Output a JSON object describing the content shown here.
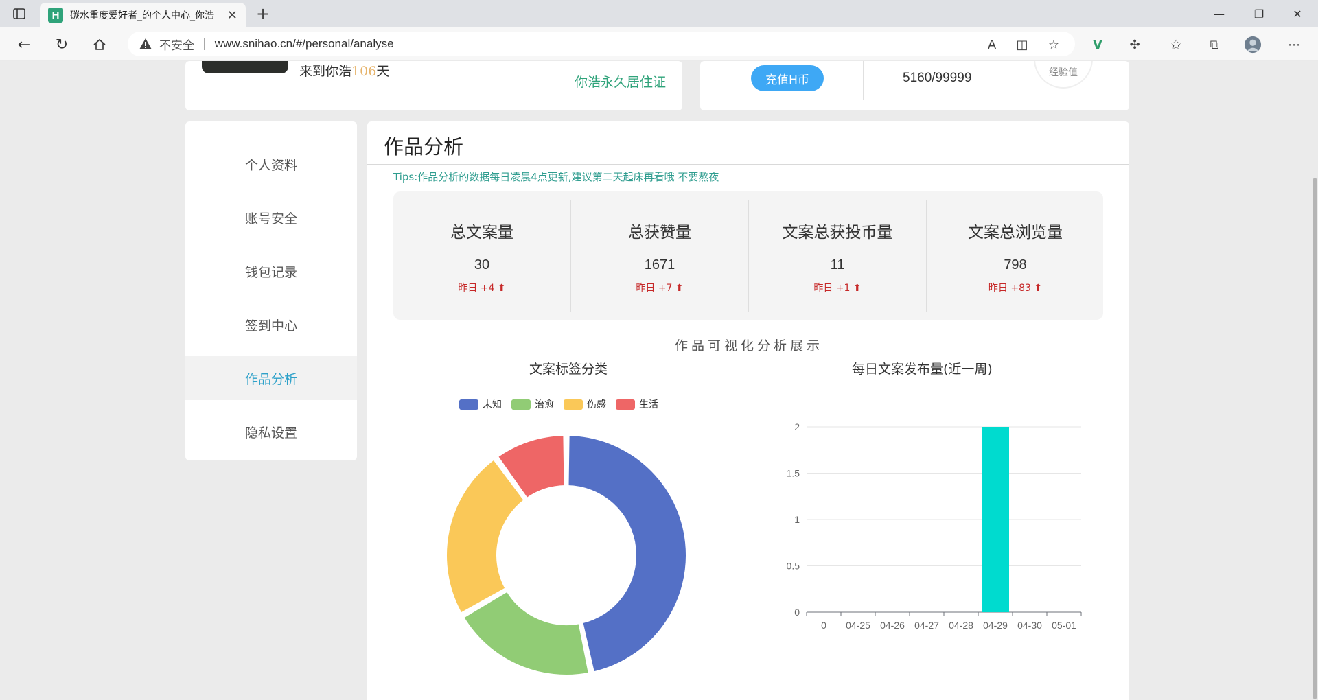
{
  "browser": {
    "tab_title": "碳水重度爱好者_的个人中心_你浩",
    "insecure_label": "不安全",
    "url": "www.snihao.cn/#/personal/analyse"
  },
  "header_left": {
    "days_prefix": "来到你浩",
    "days_number": "106",
    "days_suffix": "天",
    "permanent_link": "你浩永久居住证"
  },
  "header_right": {
    "recharge_label": "充值H币",
    "exp_value": "5160/99999",
    "exp_label": "经验值"
  },
  "sidebar": {
    "items": [
      {
        "label": "个人资料"
      },
      {
        "label": "账号安全"
      },
      {
        "label": "钱包记录"
      },
      {
        "label": "签到中心"
      },
      {
        "label": "作品分析"
      },
      {
        "label": "隐私设置"
      }
    ],
    "active_index": 4
  },
  "main": {
    "title": "作品分析",
    "tips": "Tips:作品分析的数据每日凌晨4点更新,建议第二天起床再看哦 不要熬夜",
    "stats": [
      {
        "label": "总文案量",
        "value": "30",
        "delta": "昨日 +4 ⬆"
      },
      {
        "label": "总获赞量",
        "value": "1671",
        "delta": "昨日 +7 ⬆"
      },
      {
        "label": "文案总获投币量",
        "value": "11",
        "delta": "昨日 +1 ⬆"
      },
      {
        "label": "文案总浏览量",
        "value": "798",
        "delta": "昨日 +83 ⬆"
      }
    ],
    "section_title": "作品可视化分析展示"
  },
  "chart_data": [
    {
      "type": "pie",
      "variant": "donut",
      "title": "文案标签分类",
      "legend_position": "top",
      "categories": [
        "未知",
        "治愈",
        "伤感",
        "生活"
      ],
      "values": [
        14,
        6,
        7,
        3
      ],
      "colors": [
        "#5470c6",
        "#91cc75",
        "#fac858",
        "#ee6666"
      ]
    },
    {
      "type": "bar",
      "title": "每日文案发布量(近一周)",
      "categories": [
        "0",
        "04-25",
        "04-26",
        "04-27",
        "04-28",
        "04-29",
        "04-30",
        "05-01"
      ],
      "values": [
        0,
        0,
        0,
        0,
        0,
        2,
        0,
        0
      ],
      "ylim": [
        0,
        2
      ],
      "yticks": [
        "0",
        "0.5",
        "1",
        "1.5",
        "2"
      ],
      "grid": true,
      "color": "#00dbcf"
    }
  ]
}
